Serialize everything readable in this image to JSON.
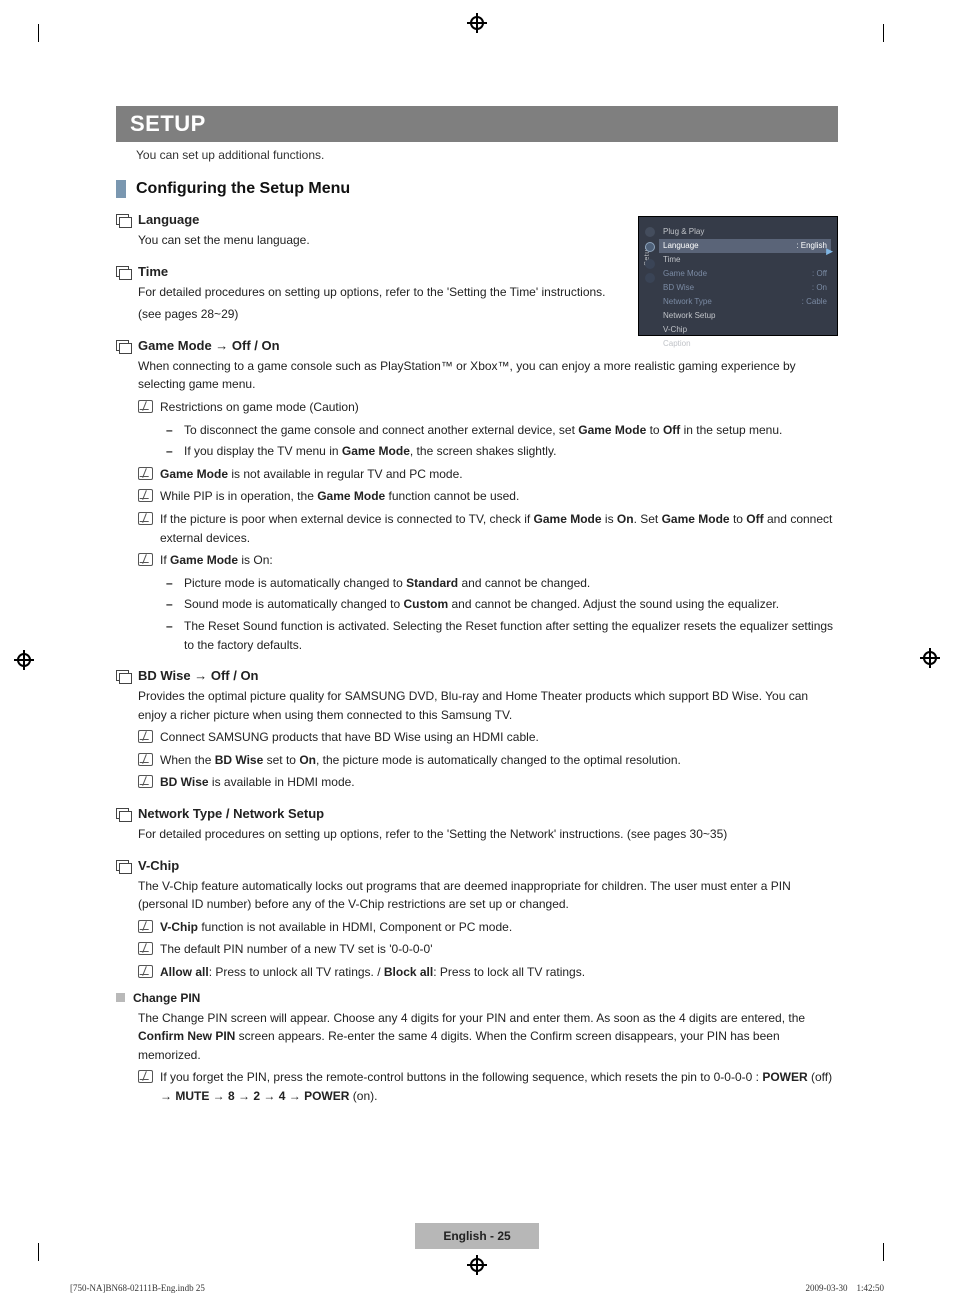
{
  "doc": {
    "title_bar": "SETUP",
    "intro": "You can set up additional functions.",
    "section_heading": "Configuring the Setup Menu",
    "screenshot": {
      "side": "Setup",
      "rows": [
        {
          "label": "Plug & Play",
          "value": ""
        },
        {
          "label": "Language",
          "value": ": English",
          "hi": true,
          "arrow": "▶"
        },
        {
          "label": "Time",
          "value": ""
        },
        {
          "label": "Game Mode",
          "value": ": Off",
          "dim": true
        },
        {
          "label": "BD Wise",
          "value": ": On",
          "dim": true
        },
        {
          "label": "Network Type",
          "value": ": Cable",
          "dim": true
        },
        {
          "label": "Network Setup",
          "value": ""
        },
        {
          "label": "V-Chip",
          "value": ""
        },
        {
          "label": "Caption",
          "value": ""
        }
      ]
    },
    "sections": {
      "language": {
        "title": "Language",
        "body": "You can set the menu language."
      },
      "time": {
        "title": "Time",
        "body1": "For detailed procedures on setting up options, refer to the 'Setting the Time' instructions.",
        "body2": "(see pages 28~29)"
      },
      "game": {
        "title": "Game Mode → Off / On",
        "intro": "When connecting to a game console such as PlayStation™ or Xbox™, you can enjoy a more realistic gaming experience by selecting game menu.",
        "n1": "Restrictions on game mode (Caution)",
        "n1d1a": "To disconnect the game console and connect another external device, set ",
        "n1d1b": "Game Mode",
        "n1d1c": " to ",
        "n1d1d": "Off",
        "n1d1e": " in the setup menu.",
        "n1d2a": "If you display the TV menu in ",
        "n1d2b": "Game Mode",
        "n1d2c": ", the screen shakes slightly.",
        "n2a": "Game Mode",
        "n2b": " is not available in regular TV and PC mode.",
        "n3a": "While PIP is in operation, the ",
        "n3b": "Game Mode",
        "n3c": " function cannot be used.",
        "n4a": "If the picture is poor when external device is connected to TV, check if ",
        "n4b": "Game Mode",
        "n4c": " is ",
        "n4d": "On",
        "n4e": ". Set ",
        "n4f": "Game Mode",
        "n4g": " to ",
        "n4h": "Off",
        "n4i": " and connect external devices.",
        "n5a": "If ",
        "n5b": "Game Mode",
        "n5c": " is On:",
        "n5d1a": "Picture mode is automatically changed to ",
        "n5d1b": "Standard",
        "n5d1c": " and cannot be changed.",
        "n5d2a": "Sound mode is automatically changed to ",
        "n5d2b": "Custom",
        "n5d2c": " and cannot be changed. Adjust the sound using the equalizer.",
        "n5d3": "The Reset Sound function is activated. Selecting the Reset function after setting the equalizer resets the equalizer settings to the factory defaults."
      },
      "bdwise": {
        "title": "BD Wise → Off / On",
        "intro": "Provides the optimal picture quality for SAMSUNG DVD, Blu-ray and Home Theater products which support BD Wise. You can enjoy a richer picture when using them connected to this Samsung TV.",
        "n1": "Connect SAMSUNG products that have BD Wise using an HDMI cable.",
        "n2a": "When the ",
        "n2b": "BD Wise",
        "n2c": " set to ",
        "n2d": "On",
        "n2e": ", the picture mode is automatically changed to the optimal resolution.",
        "n3a": "BD Wise",
        "n3b": " is available in HDMI mode."
      },
      "network": {
        "title": "Network Type / Network Setup",
        "body": "For detailed procedures on setting up options, refer to the 'Setting the Network' instructions. (see pages 30~35)"
      },
      "vchip": {
        "title": "V-Chip",
        "intro": "The V-Chip feature automatically locks out programs that are deemed inappropriate for children. The user must enter a PIN (personal ID number) before any of the V-Chip restrictions are set up or changed.",
        "n1a": "V-Chip",
        "n1b": " function is not available in HDMI, Component or PC mode.",
        "n2": "The default PIN number of a new TV set is '0-0-0-0'",
        "n3a": "Allow all",
        "n3b": ": Press to unlock all TV ratings. / ",
        "n3c": "Block all",
        "n3d": ": Press to lock all TV ratings.",
        "sub_title": "Change PIN",
        "sub1a": "The Change PIN screen will appear. Choose any 4 digits for your PIN and enter them. As soon as the 4 digits are entered, the ",
        "sub1b": "Confirm New PIN",
        "sub1c": " screen appears. Re-enter the same 4 digits. When the Confirm screen disappears, your PIN has been memorized.",
        "sub_n1a": "If you forget the PIN, press the remote-control buttons in the following sequence, which resets the pin to 0-0-0-0 : ",
        "sub_n1b": "POWER",
        "sub_n1c": " (off) → ",
        "sub_n1d": "MUTE",
        "sub_n1e": " → ",
        "sub_n1f": "8",
        "sub_n1g": " → ",
        "sub_n1h": "2",
        "sub_n1i": " → ",
        "sub_n1j": "4",
        "sub_n1k": " → ",
        "sub_n1l": "POWER",
        "sub_n1m": " (on)."
      }
    },
    "page_footer": "English - 25",
    "doc_footer_left": "[750-NA]BN68-02111B-Eng.indb   25",
    "doc_footer_right": "2009-03-30      1:42:50"
  }
}
